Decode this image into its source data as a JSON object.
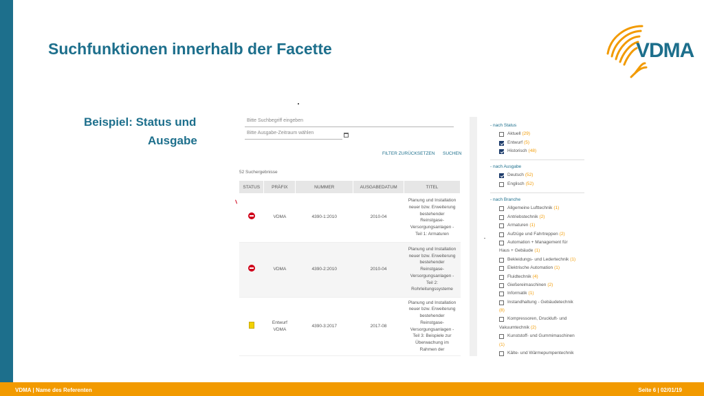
{
  "slide": {
    "title": "Suchfunktionen innerhalb der Facette",
    "example_line1": "Beispiel: Status und",
    "example_line2": "Ausgabe",
    "logo_text": "VDMA",
    "footer_left": "VDMA | Name des Referenten",
    "footer_right": "Seite 6 | 02/01/19",
    "colors": {
      "brand_blue": "#1d6f8c",
      "brand_orange": "#f29a00",
      "status_red": "#d0021b"
    }
  },
  "search": {
    "term_placeholder": "Bitte Suchbegriff eingeben",
    "date_placeholder": "Bitte Ausgabe-Zeitraum wählen",
    "reset_label": "FILTER ZURÜCKSETZEN",
    "search_label": "SUCHEN",
    "results_count": "52 Suchergebnisse"
  },
  "table": {
    "headers": [
      "STATUS",
      "PRÄFIX",
      "NUMMER",
      "AUSGABEDATUM",
      "TITEL"
    ],
    "rows": [
      {
        "status_icon": "withdrawn-icon",
        "prefix": "VDMA",
        "number": "4390-1:2010",
        "date": "2010-04",
        "title": [
          "Planung und Installation",
          "neuer bzw. Erweiterung",
          "bestehender",
          "Reinstgase-",
          "Versorgungsanlagen -",
          "Teil 1: Armaturen"
        ]
      },
      {
        "status_icon": "withdrawn-icon",
        "prefix": "VDMA",
        "number": "4390-2:2010",
        "date": "2010-04",
        "title": [
          "Planung und Installation",
          "neuer bzw. Erweiterung",
          "bestehender",
          "Reinstgase-",
          "Versorgungsanlagen -",
          "Teil 2:",
          "Rohrleitungssysteme"
        ]
      },
      {
        "status_icon": "draft-icon",
        "prefix": "Entwurf",
        "prefix2": "VDMA",
        "number": "4390-3:2017",
        "date": "2017-08",
        "title": [
          "Planung und Installation",
          "neuer bzw. Erweiterung",
          "bestehender",
          "Reinstgase-",
          "Versorgungsanlagen -",
          "Teil 3: Beispiele zur",
          "Überwachung im",
          "Rahmen der"
        ]
      }
    ]
  },
  "facets": {
    "status": {
      "heading": "- nach Status",
      "items": [
        {
          "label": "Aktuell",
          "count": "(29)",
          "checked": false
        },
        {
          "label": "Entwurf",
          "count": "(5)",
          "checked": true
        },
        {
          "label": "Historisch",
          "count": "(48)",
          "checked": true
        }
      ]
    },
    "ausgabe": {
      "heading": "- nach Ausgabe",
      "items": [
        {
          "label": "Deutsch",
          "count": "(52)",
          "checked": true
        },
        {
          "label": "Englisch",
          "count": "(52)",
          "checked": false
        }
      ]
    },
    "branche": {
      "heading": "- nach Branche",
      "items": [
        {
          "label": "Allgemeine Lufttechnik",
          "count": "(1)"
        },
        {
          "label": "Antriebstechnik",
          "count": "(2)"
        },
        {
          "label": "Armaturen",
          "count": "(1)"
        },
        {
          "label": "Aufzüge und Fahrtreppen",
          "count": "(2)"
        },
        {
          "label": "Automation + Management für",
          "cont": "Haus + Gebäude",
          "count": "(1)"
        },
        {
          "label": "Bekleidungs- und Ledertechnik",
          "count": "(1)"
        },
        {
          "label": "Elektrische Automation",
          "count": "(1)"
        },
        {
          "label": "Fluidtechnik",
          "count": "(4)"
        },
        {
          "label": "Gießereimaschinen",
          "count": "(2)"
        },
        {
          "label": "Informatik",
          "count": "(1)"
        },
        {
          "label": "Instandhaltung - Gebäudetechnik",
          "cont": "",
          "count": "(8)"
        },
        {
          "label": "Kompressoren, Druckluft- und",
          "cont": "Vakuumtechnik",
          "count": "(2)"
        },
        {
          "label": "Kunststoff- und Gummimaschinen",
          "cont": "",
          "count": "(1)"
        },
        {
          "label": "Kälte- und Wärmepumpentechnik",
          "count": ""
        }
      ]
    }
  }
}
